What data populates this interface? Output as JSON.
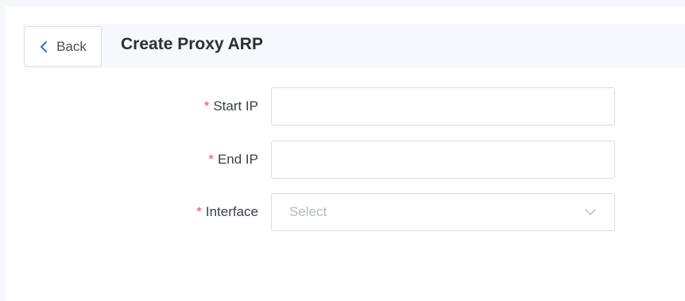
{
  "header": {
    "back_label": "Back",
    "title": "Create Proxy ARP"
  },
  "form": {
    "start_ip": {
      "required_mark": "*",
      "label": "Start IP",
      "value": "",
      "placeholder": ""
    },
    "end_ip": {
      "required_mark": "*",
      "label": "End IP",
      "value": "",
      "placeholder": ""
    },
    "interface": {
      "required_mark": "*",
      "label": "Interface",
      "placeholder": "Select"
    }
  },
  "icons": {
    "back": "chevron-left-icon",
    "select": "chevron-down-icon"
  },
  "colors": {
    "accent": "#2a6ff0",
    "required": "#f5455c",
    "header_bg": "#f6f8fc"
  }
}
